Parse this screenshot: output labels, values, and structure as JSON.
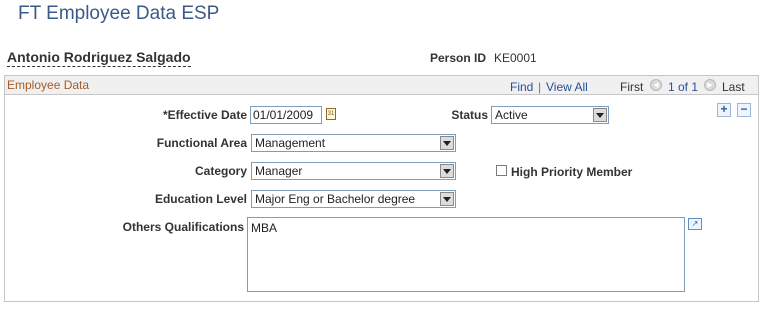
{
  "page": {
    "title": "FT Employee Data ESP"
  },
  "person": {
    "name": "Antonio Rodriguez Salgado",
    "id_label": "Person ID",
    "id_value": "KE0001"
  },
  "section": {
    "title": "Employee Data",
    "nav": {
      "find": "Find",
      "sep": "|",
      "view_all": "View All",
      "first": "First",
      "counter": "1 of 1",
      "last": "Last"
    }
  },
  "form": {
    "effective_date": {
      "label": "*Effective Date",
      "value": "01/01/2009"
    },
    "status": {
      "label": "Status",
      "value": "Active"
    },
    "functional_area": {
      "label": "Functional Area",
      "value": "Management"
    },
    "category": {
      "label": "Category",
      "value": "Manager"
    },
    "high_priority": {
      "label": "High Priority Member",
      "checked": false
    },
    "education_level": {
      "label": "Education Level",
      "value": "Major Eng or Bachelor degree"
    },
    "others_qualifications": {
      "label": "Others Qualifications",
      "value": "MBA"
    }
  },
  "controls": {
    "add": "+",
    "remove": "−"
  },
  "icons": {
    "calendar": "calendar-icon",
    "prev": "chevron-left-icon",
    "next": "chevron-right-icon",
    "expand": "expand-text-icon"
  },
  "colors": {
    "title": "#3c5a87",
    "section_title": "#a85a27",
    "link": "#25509b"
  }
}
